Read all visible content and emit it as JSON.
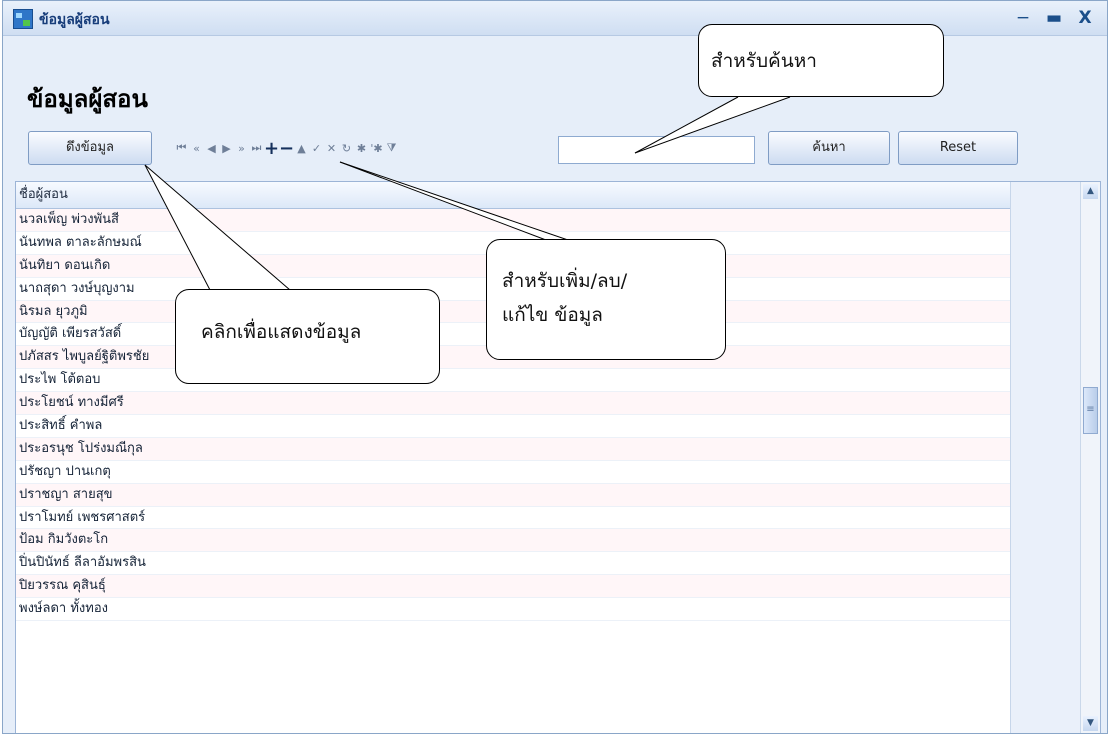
{
  "window": {
    "title": "ข้อมูลผู้สอน",
    "controls": {
      "minimize": "−",
      "maximize": "▬",
      "close": "X"
    }
  },
  "page": {
    "heading": "ข้อมูลผู้สอน"
  },
  "toolbar": {
    "fetch_label": "ดึงข้อมูล",
    "nav": {
      "first": "⏮",
      "prev_page": "«",
      "prev": "◀",
      "next": "▶",
      "next_page": "»",
      "last": "⏭",
      "add": "+",
      "remove": "−",
      "edit": "▲",
      "apply": "✓",
      "cancel": "✕",
      "refresh": "↻",
      "star": "✱",
      "star_filter": "'✱",
      "filter": "⧩"
    },
    "search_value": "",
    "search_label": "ค้นหา",
    "reset_label": "Reset"
  },
  "grid": {
    "column": "ชื่อผู้สอน",
    "rows": [
      "นวลเพ็ญ พ่วงพันสี",
      "นันทพล ตาละลักษมณ์",
      "นันทิยา ดอนเกิด",
      "นาถสุดา วงษ์บุญงาม",
      "นิรมล ยุวภูมิ",
      "บัญญัติ เพียรสวัสดิ์",
      "ปภัสสร ไพบูลย์ฐิติพรชัย",
      "ประไพ โต้ตอบ",
      "ประโยชน์ ทางมีศรี",
      "ประสิทธิ์ คำพล",
      "ประอรนุช โปร่งมณีกุล",
      "ปรัชญา ปานเกตุ",
      "ปราชญา สายสุข",
      "ปราโมทย์ เพชรศาสตร์",
      "ป้อม กิมวังตะโก",
      "ปิ่นปินัทธ์ ลีลาอัมพรสิน",
      "ปิยวรรณ คุสินธุ์",
      "พงษ์ลดา ทั้งทอง"
    ]
  },
  "scrollbar": {
    "up": "▲",
    "thumb": "≡",
    "down": "▼"
  },
  "annotations": {
    "search_note": "สำหรับค้นหา",
    "fetch_note": "คลิกเพื่อแสดงข้อมูล",
    "edit_note": [
      "สำหรับเพิ่ม/ลบ/",
      "แก้ไข ข้อมูล"
    ]
  }
}
